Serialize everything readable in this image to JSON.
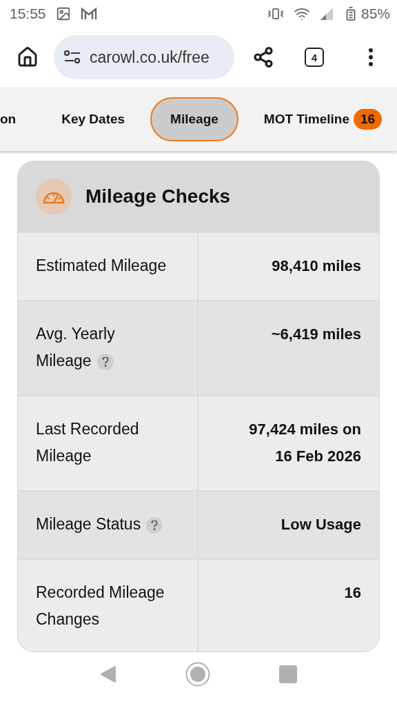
{
  "status_bar": {
    "time": "15:55",
    "battery": "85%"
  },
  "browser": {
    "url": "carowl.co.uk/free",
    "tab_count": "4"
  },
  "tabs": [
    {
      "label": "on",
      "selected": false
    },
    {
      "label": "Key Dates",
      "selected": false
    },
    {
      "label": "Mileage",
      "selected": true
    },
    {
      "label": "MOT Timeline",
      "selected": false,
      "badge": "16"
    }
  ],
  "card": {
    "title": "Mileage Checks",
    "rows": [
      {
        "label": "Estimated Mileage",
        "value": "98,410 miles",
        "help": false
      },
      {
        "label": "Avg. Yearly Mileage",
        "value": "~6,419 miles",
        "help": true
      },
      {
        "label": "Last Recorded Mileage",
        "value": "97,424 miles on 16 Feb 2026",
        "help": false
      },
      {
        "label": "Mileage Status",
        "value": "Low Usage",
        "help": true
      },
      {
        "label": "Recorded Mileage Changes",
        "value": "16",
        "help": false
      }
    ]
  }
}
